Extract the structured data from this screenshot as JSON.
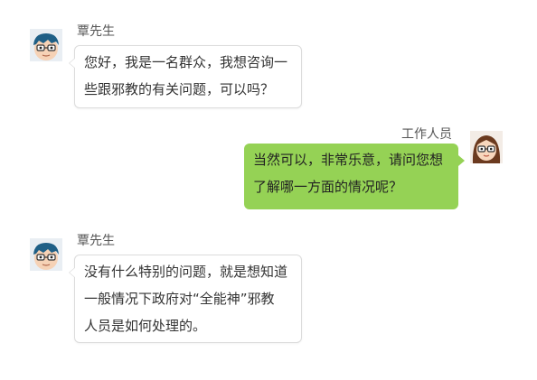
{
  "messages": [
    {
      "sender": "覃先生",
      "side": "left",
      "avatar_icon": "boy-with-glasses-avatar",
      "lines": [
        "您好，我是一名群众，我想咨询一",
        "些跟邪教的有关问题，可以吗？"
      ]
    },
    {
      "sender": "工作人员",
      "side": "right",
      "avatar_icon": "girl-with-glasses-avatar",
      "lines": [
        "当然可以，非常乐意，请问您想",
        "了解哪一方面的情况呢？"
      ]
    },
    {
      "sender": "覃先生",
      "side": "left",
      "avatar_icon": "boy-with-glasses-avatar",
      "lines": [
        "没有什么特别的问题，就是想知道",
        "一般情况下政府对“全能神”邪教",
        "人员是如何处理的。"
      ]
    }
  ],
  "colors": {
    "self_bubble": "#95d255",
    "other_bubble": "#ffffff",
    "other_bubble_border": "#dcdcdc"
  }
}
